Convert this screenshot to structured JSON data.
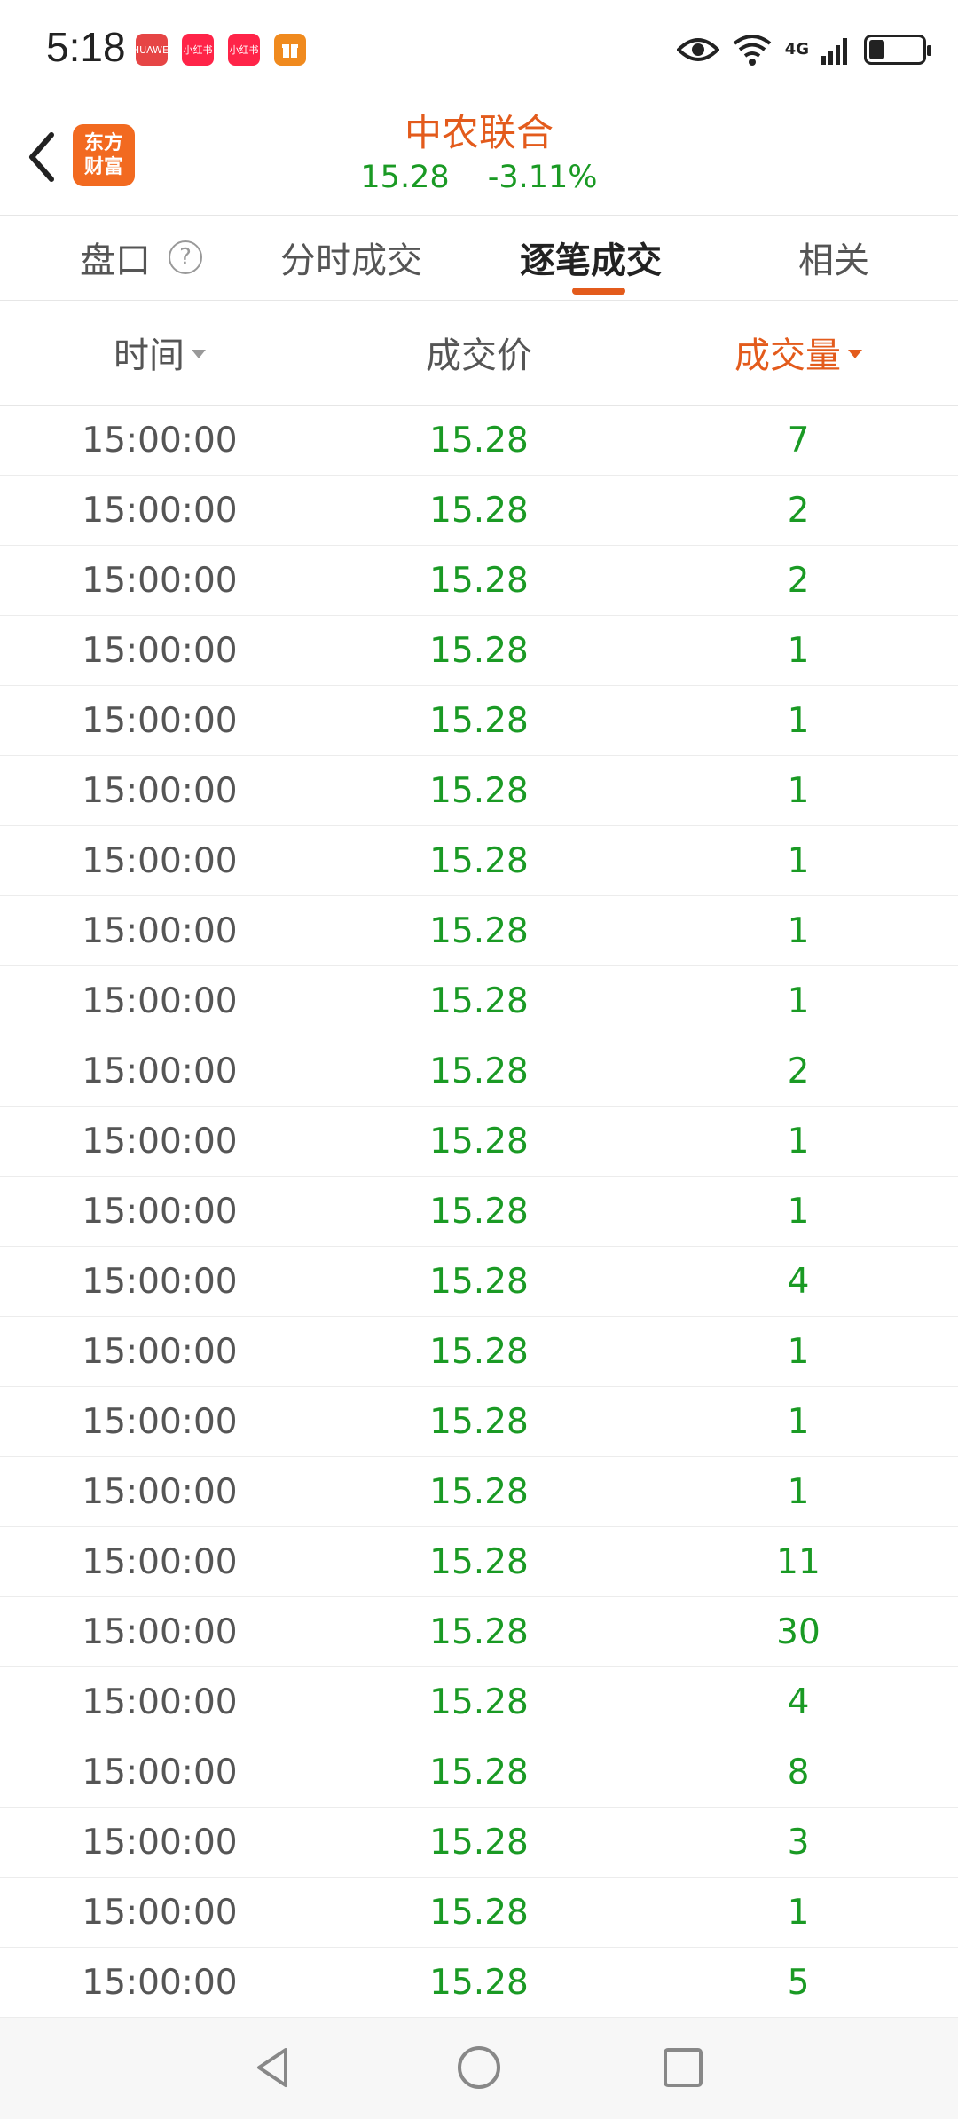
{
  "status_bar": {
    "time": "5:18",
    "notifications": [
      "HUAWEI",
      "小红书",
      "小红书",
      "gift"
    ],
    "network_label": "4G",
    "battery_level": 0.3
  },
  "header": {
    "back_icon": "chevron-left-icon",
    "logo_line1": "东方",
    "logo_line2": "财富",
    "stock_name": "中农联合",
    "price": "15.28",
    "change": "-3.11%"
  },
  "tabs": [
    {
      "label": "盘口",
      "help": "?"
    },
    {
      "label": "分时成交"
    },
    {
      "label": "逐笔成交",
      "active": true
    },
    {
      "label": "相关"
    }
  ],
  "columns": {
    "time": "时间",
    "price": "成交价",
    "volume": "成交量"
  },
  "trades": [
    {
      "time": "15:00:00",
      "price": "15.28",
      "volume": "7"
    },
    {
      "time": "15:00:00",
      "price": "15.28",
      "volume": "2"
    },
    {
      "time": "15:00:00",
      "price": "15.28",
      "volume": "2"
    },
    {
      "time": "15:00:00",
      "price": "15.28",
      "volume": "1"
    },
    {
      "time": "15:00:00",
      "price": "15.28",
      "volume": "1"
    },
    {
      "time": "15:00:00",
      "price": "15.28",
      "volume": "1"
    },
    {
      "time": "15:00:00",
      "price": "15.28",
      "volume": "1"
    },
    {
      "time": "15:00:00",
      "price": "15.28",
      "volume": "1"
    },
    {
      "time": "15:00:00",
      "price": "15.28",
      "volume": "1"
    },
    {
      "time": "15:00:00",
      "price": "15.28",
      "volume": "2"
    },
    {
      "time": "15:00:00",
      "price": "15.28",
      "volume": "1"
    },
    {
      "time": "15:00:00",
      "price": "15.28",
      "volume": "1"
    },
    {
      "time": "15:00:00",
      "price": "15.28",
      "volume": "4"
    },
    {
      "time": "15:00:00",
      "price": "15.28",
      "volume": "1"
    },
    {
      "time": "15:00:00",
      "price": "15.28",
      "volume": "1"
    },
    {
      "time": "15:00:00",
      "price": "15.28",
      "volume": "1"
    },
    {
      "time": "15:00:00",
      "price": "15.28",
      "volume": "11"
    },
    {
      "time": "15:00:00",
      "price": "15.28",
      "volume": "30"
    },
    {
      "time": "15:00:00",
      "price": "15.28",
      "volume": "4"
    },
    {
      "time": "15:00:00",
      "price": "15.28",
      "volume": "8"
    },
    {
      "time": "15:00:00",
      "price": "15.28",
      "volume": "3"
    },
    {
      "time": "15:00:00",
      "price": "15.28",
      "volume": "1"
    },
    {
      "time": "15:00:00",
      "price": "15.28",
      "volume": "5"
    }
  ],
  "colors": {
    "accent": "#e35b1c",
    "down": "#1a9a24",
    "text": "#555555"
  },
  "nav": [
    "back-triangle-icon",
    "home-circle-icon",
    "recents-square-icon"
  ]
}
